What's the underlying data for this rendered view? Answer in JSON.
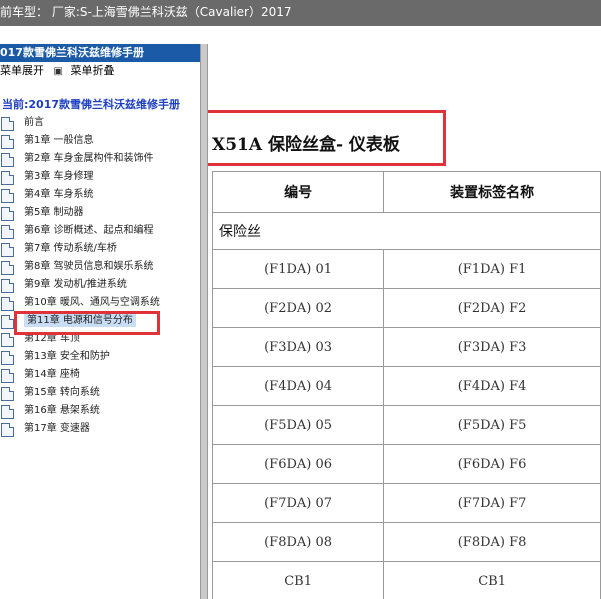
{
  "topbar": {
    "text": "前车型：  厂家:S-上海雪佛兰科沃兹（Cavalier）2017"
  },
  "sidebar": {
    "header": "017款雪佛兰科沃兹维修手册",
    "expand_label": "菜单展开",
    "collapse_label": "菜单折叠",
    "current": "当前:2017款雪佛兰科沃兹维修手册",
    "items": [
      {
        "label": "前言"
      },
      {
        "label": "第1章 一般信息"
      },
      {
        "label": "第2章 车身金属构件和装饰件"
      },
      {
        "label": "第3章 车身修理"
      },
      {
        "label": "第4章 车身系统"
      },
      {
        "label": "第5章 制动器"
      },
      {
        "label": "第6章 诊断概述、起点和编程"
      },
      {
        "label": "第7章 传动系统/车桥"
      },
      {
        "label": "第8章 驾驶员信息和娱乐系统"
      },
      {
        "label": "第9章 发动机/推进系统"
      },
      {
        "label": "第10章 暖风、通风与空调系统"
      },
      {
        "label": "第11章 电源和信号分布",
        "selected": true
      },
      {
        "label": "第12章 车顶"
      },
      {
        "label": "第13章 安全和防护"
      },
      {
        "label": "第14章 座椅"
      },
      {
        "label": "第15章 转向系统"
      },
      {
        "label": "第16章 悬架系统"
      },
      {
        "label": "第17章 变速器"
      }
    ]
  },
  "content": {
    "title": "X51A 保险丝盒- 仪表板",
    "table": {
      "headers": [
        "编号",
        "装置标签名称"
      ],
      "section": "保险丝",
      "rows": [
        [
          "(F1DA) 01",
          "(F1DA) F1"
        ],
        [
          "(F2DA) 02",
          "(F2DA) F2"
        ],
        [
          "(F3DA) 03",
          "(F3DA) F3"
        ],
        [
          "(F4DA) 04",
          "(F4DA) F4"
        ],
        [
          "(F5DA) 05",
          "(F5DA) F5"
        ],
        [
          "(F6DA) 06",
          "(F6DA) F6"
        ],
        [
          "(F7DA) 07",
          "(F7DA) F7"
        ],
        [
          "(F8DA) 08",
          "(F8DA) F8"
        ],
        [
          "CB1",
          "CB1"
        ]
      ]
    }
  },
  "colors": {
    "highlight": "#e0323a",
    "sidebar_header": "#1a5aa6",
    "current_text": "#1c3ec0",
    "topbar": "#6a6a6a"
  }
}
